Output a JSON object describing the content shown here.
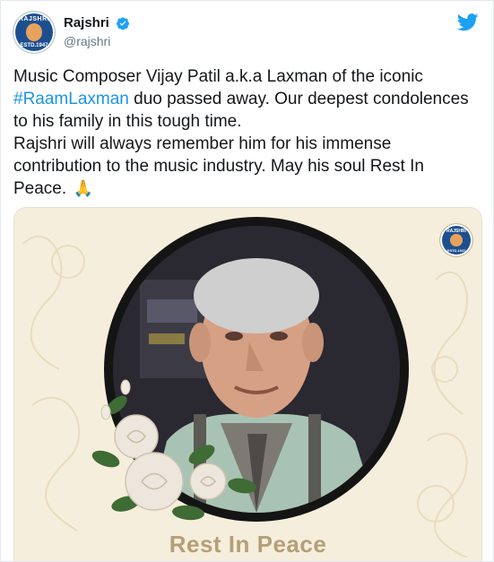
{
  "account": {
    "display_name": "Rajshri",
    "handle": "@rajshri",
    "verified": true,
    "avatar_icon": "rajshri-logo-icon",
    "logo_text_top": "RAJSHRI",
    "logo_text_bottom": "ESTD.1947"
  },
  "tweet": {
    "line_1_before": "Music Composer Vijay Patil a.k.a Laxman of the iconic",
    "hashtag": "#RaamLaxman",
    "line_1_after": " duo passed away. Our deepest condolences to his family in this tough time.",
    "line_2": "Rajshri will always remember him for his immense contribution to the music industry. May his soul Rest In Peace.",
    "emoji": "🙏"
  },
  "media": {
    "caption": "Rest In Peace",
    "seal_top": "RAJSHRI",
    "seal_bottom": "ESTD.1947"
  },
  "colors": {
    "link": "#1b95e0",
    "twitter_blue": "#1da1f2",
    "caption": "#b49f78"
  }
}
